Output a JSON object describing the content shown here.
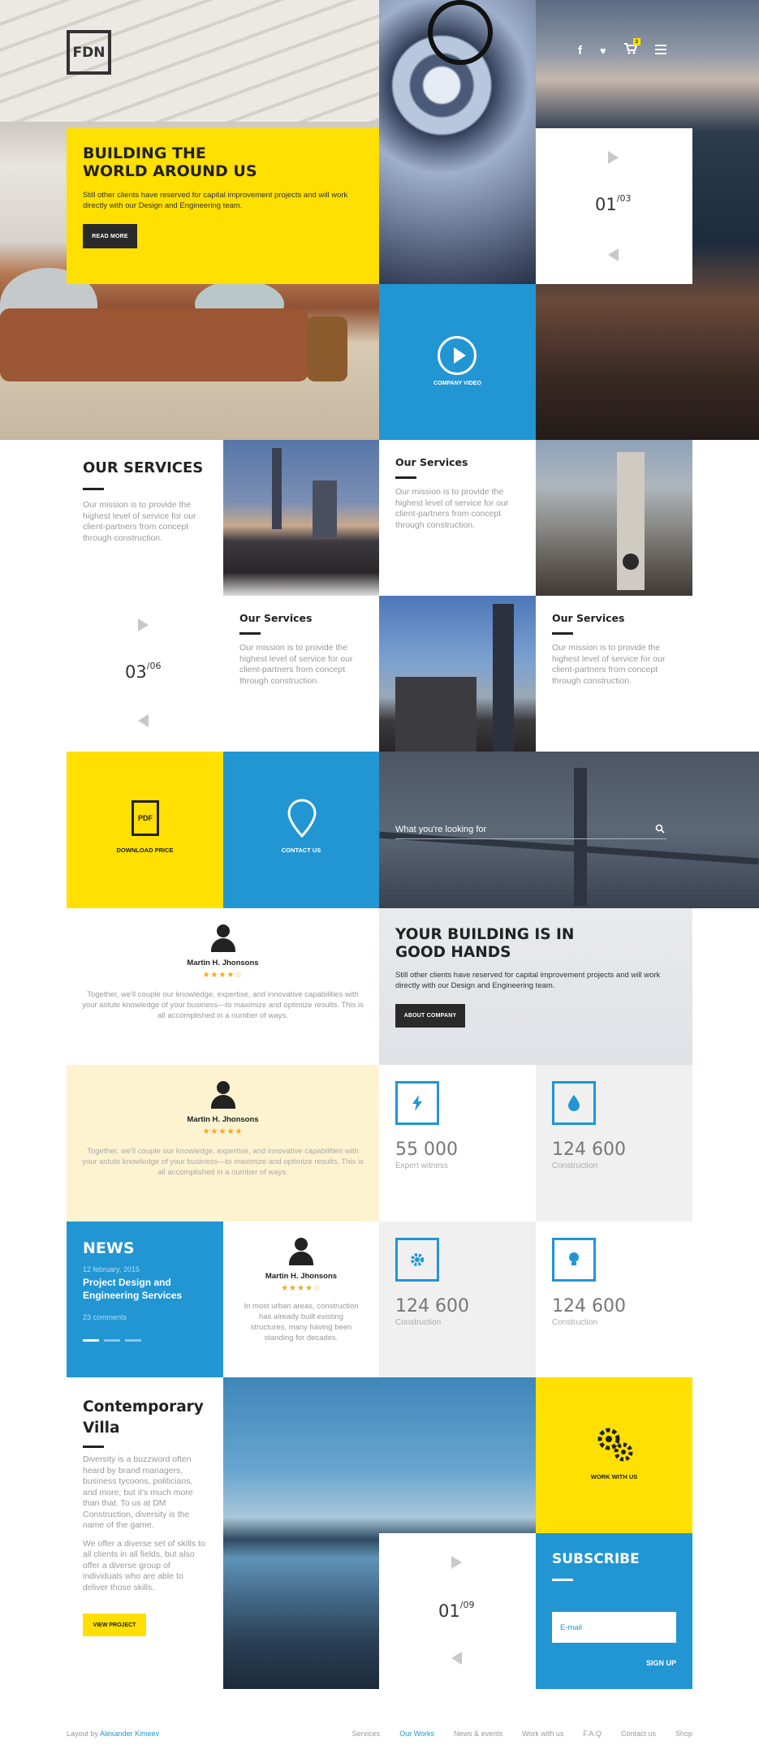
{
  "header": {
    "logo": "FDN",
    "cart_count": "3",
    "icons": [
      "facebook-icon",
      "twitter-icon",
      "cart-icon",
      "menu-icon"
    ]
  },
  "hero": {
    "title_line1": "BUILDING THE",
    "title_line2": "WORLD AROUND US",
    "text": "Still other clients have reserved for capital improvement projects and will work directly with our Design and Engineering team.",
    "button": "READ MORE",
    "slider_current": "01",
    "slider_total": "/03"
  },
  "video": {
    "label": "COMPANY VIDEO"
  },
  "services": {
    "title": "OUR SERVICES",
    "text": "Our mission is to provide the highest level of service for our client-partners from concept through construction.",
    "items": [
      {
        "title": "Our Services",
        "text": "Our mission is to provide the highest level of service for our client-partners from concept through construction."
      },
      {
        "title": "Our Services",
        "text": "Our mission is to provide the highest level of service for our client-partners from concept through construction."
      },
      {
        "title": "Our Services",
        "text": "Our mission is to provide the highest level of service for our client-partners from concept through construction."
      }
    ],
    "slider_current": "03",
    "slider_total": "/06"
  },
  "actions": {
    "download": "DOWNLOAD PRICE",
    "pdf": "PDF",
    "contact": "CONTACT US",
    "search_placeholder": "What you're looking for"
  },
  "testimonials": [
    {
      "name": "Martin H. Jhonsons",
      "stars": "★★★★☆",
      "text": "Together, we'll couple our knowledge, expertise, and innovative capabilities with your astute knowledge of your business—to maximize and optimize results. This is all accomplished in a number of ways."
    },
    {
      "name": "Martin H. Jhonsons",
      "stars": "★★★★★",
      "text": "Together, we'll couple our knowledge, expertise, and innovative capabilities with your astute knowledge of your business—to maximize and optimize results. This is all accomplished in a number of ways."
    },
    {
      "name": "Martin H. Jhonsons",
      "stars": "★★★★☆",
      "text": "In most urban areas, construction has already built existing structures, many having been standing for decades."
    }
  ],
  "about": {
    "title_line1": "YOUR BUILDING IS IN",
    "title_line2": "GOOD HANDS",
    "text": "Still other clients have reserved for capital improvement projects and will work directly with our Design and Engineering team.",
    "button": "ABOUT COMPANY"
  },
  "stats": [
    {
      "value": "55 000",
      "label": "Expert witness",
      "icon": "lightning-icon"
    },
    {
      "value": "124 600",
      "label": "Construction",
      "icon": "drop-icon"
    },
    {
      "value": "124 600",
      "label": "Construction",
      "icon": "gear-icon"
    },
    {
      "value": "124 600",
      "label": "Construction",
      "icon": "bulb-icon"
    }
  ],
  "news": {
    "title": "NEWS",
    "date": "12 february, 2015",
    "headline": "Project Design and Engineering Services",
    "comments": "23 comments"
  },
  "villa": {
    "title_line1": "Contemporary",
    "title_line2": "Villa",
    "p1": "Diversity is a buzzword often heard by brand managers, business tycoons, politicians, and more; but it's much more than that. To us at DM Construction, diversity is the name of the game.",
    "p2": "We offer a diverse set of skills to all clients in all fields, but also offer a diverse group of individuals who are able to deliver those skills.",
    "button": "VIEW PROJECT",
    "slider_current": "01",
    "slider_total": "/09"
  },
  "work": {
    "label": "WORK WITH US"
  },
  "subscribe": {
    "title": "SUBSCRIBE",
    "placeholder": "E-mail",
    "button": "SIGN UP"
  },
  "footer": {
    "credit_prefix": "Layout by ",
    "credit_name": "Alexander Kimeev",
    "links": [
      "Services",
      "Our Works",
      "News & events",
      "Work with us",
      "F.A.Q",
      "Contact us",
      "Shop"
    ]
  },
  "colors": {
    "yellow": "#ffe000",
    "blue": "#2196d3",
    "dark": "#222222",
    "cream": "#fdf3d0"
  }
}
